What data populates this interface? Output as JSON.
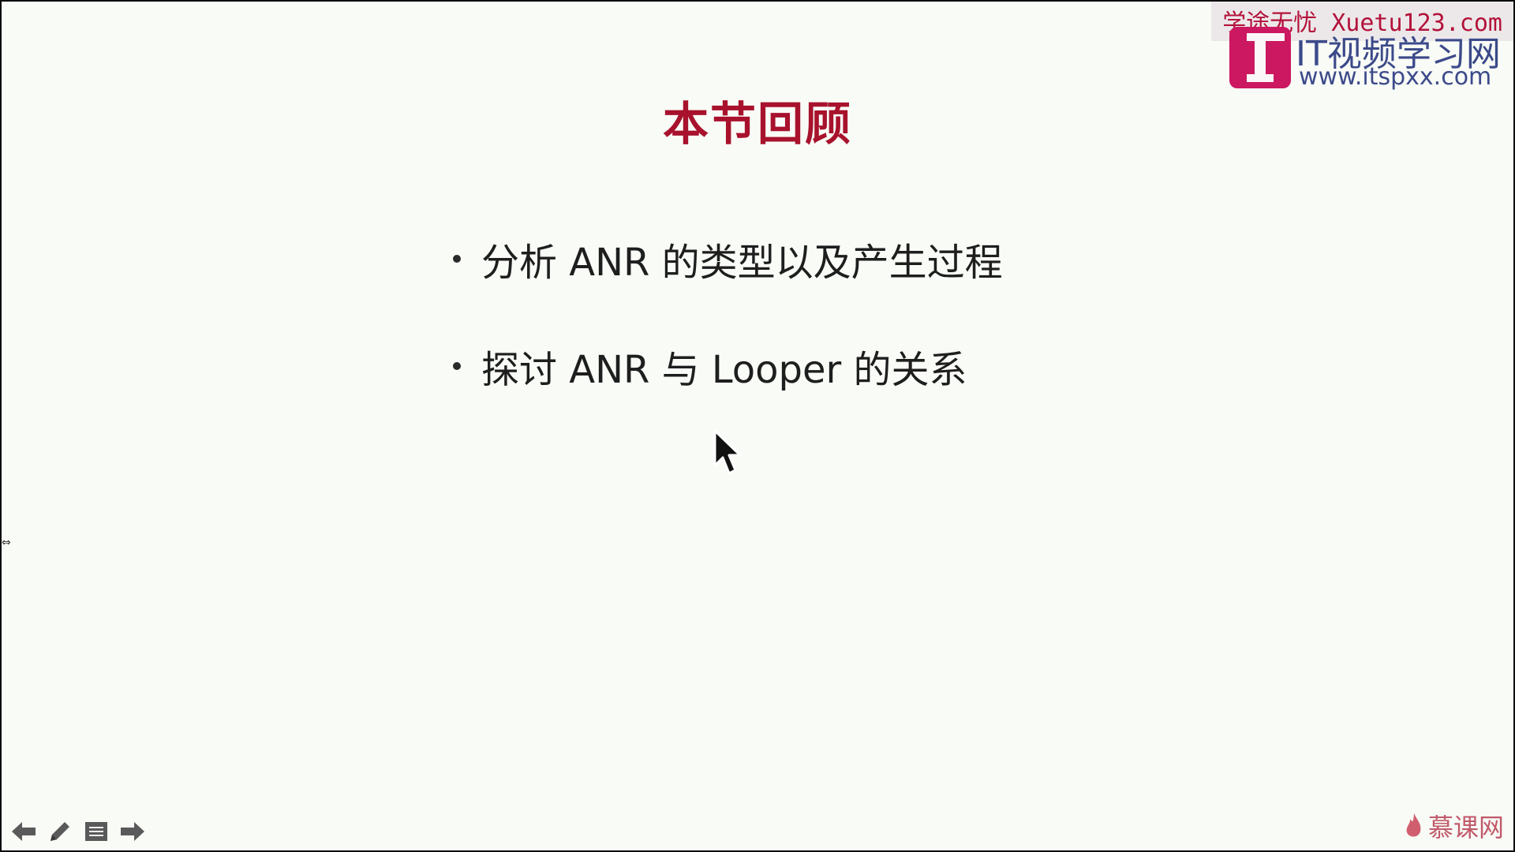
{
  "slide": {
    "title": "本节回顾",
    "bullets": [
      "分析 ANR 的类型以及产生过程",
      "探讨 ANR 与 Looper 的关系"
    ]
  },
  "watermarks": {
    "top_text": "学途无忧 Xuetu123.com",
    "site_name": "IT视频学习网",
    "site_url": "www.itspxx.com",
    "brand_bottom": "慕课网"
  },
  "toolbar": {
    "icons": [
      "arrow-left-icon",
      "pen-icon",
      "menu-icon",
      "arrow-right-icon"
    ]
  },
  "colors": {
    "title": "#a8122c",
    "slide_background": "#f8fbf6",
    "watermark_red": "#b3123a",
    "logo_magenta": "#cc1860"
  }
}
